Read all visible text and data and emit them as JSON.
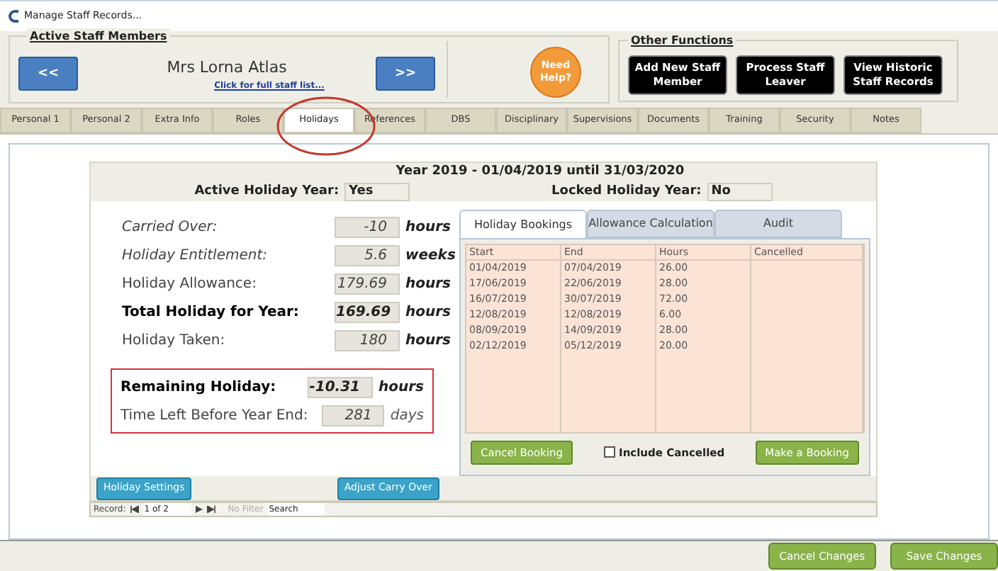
{
  "window": {
    "title": "Manage Staff Records..."
  },
  "header": {
    "section_title": "Active Staff Members",
    "prev": "<<",
    "staff_name": "Mrs Lorna Atlas",
    "staff_link": "Click for full staff list...",
    "next": ">>",
    "help": "Need Help?",
    "other_title": "Other Functions",
    "actions": [
      "Add New Staff Member",
      "Process Staff Leaver",
      "View Historic Staff Records"
    ]
  },
  "tabs": [
    {
      "label": "Personal 1",
      "selected": false
    },
    {
      "label": "Personal 2",
      "selected": false
    },
    {
      "label": "Extra Info",
      "selected": false
    },
    {
      "label": "Roles",
      "selected": false
    },
    {
      "label": "Holidays",
      "selected": true
    },
    {
      "label": "References",
      "selected": false
    },
    {
      "label": "DBS",
      "selected": false
    },
    {
      "label": "Disciplinary",
      "selected": false
    },
    {
      "label": "Supervisions",
      "selected": false
    },
    {
      "label": "Documents",
      "selected": false
    },
    {
      "label": "Training",
      "selected": false
    },
    {
      "label": "Security",
      "selected": false
    },
    {
      "label": "Notes",
      "selected": false
    }
  ],
  "year": {
    "title": "Year 2019 - 01/04/2019 until 31/03/2020",
    "active_label": "Active Holiday Year:",
    "active_value": "Yes",
    "locked_label": "Locked Holiday Year:",
    "locked_value": "No"
  },
  "fields": [
    {
      "kind": "italic",
      "label": "Carried Over:",
      "value": "-10",
      "unit": "hours"
    },
    {
      "kind": "italic",
      "label": "Holiday Entitlement:",
      "value": "5.6",
      "unit": "weeks"
    },
    {
      "kind": "plain",
      "label": "Holiday Allowance:",
      "value": "179.69",
      "unit": "hours"
    },
    {
      "kind": "bold",
      "label": "Total Holiday for Year:",
      "value": "169.69",
      "unit": "hours"
    },
    {
      "kind": "plain",
      "label": "Holiday Taken:",
      "value": "180",
      "unit": "hours"
    }
  ],
  "remaining": [
    {
      "kind": "bold",
      "label": "Remaining Holiday:",
      "value": "-10.31",
      "unit": "hours"
    },
    {
      "kind": "plain",
      "label": "Time Left Before Year End:",
      "value": "281",
      "unit": "days"
    }
  ],
  "left_buttons": [
    "Holiday Settings",
    "Adjust Carry Over"
  ],
  "record_nav": {
    "label": "Record:",
    "position": "1 of 2",
    "filter": "No Filter",
    "search": "Search"
  },
  "subtabs": [
    {
      "label": "Holiday Bookings",
      "selected": true
    },
    {
      "label": "Allowance Calculation",
      "selected": false
    },
    {
      "label": "Audit",
      "selected": false
    }
  ],
  "table": {
    "columns": [
      "Start",
      "End",
      "Hours",
      "Cancelled"
    ],
    "rows": [
      [
        "01/04/2019",
        "07/04/2019",
        "26.00"
      ],
      [
        "17/06/2019",
        "22/06/2019",
        "28.00"
      ],
      [
        "16/07/2019",
        "30/07/2019",
        "72.00"
      ],
      [
        "12/08/2019",
        "12/08/2019",
        "6.00"
      ],
      [
        "08/09/2019",
        "14/09/2019",
        "28.00"
      ],
      [
        "02/12/2019",
        "05/12/2019",
        "20.00"
      ]
    ]
  },
  "cancel_booking": "Cancel Booking",
  "include_cancelled": {
    "label": "Include Cancelled",
    "checked": false
  },
  "make_booking": "Make a Booking",
  "footer_buttons": [
    "Cancel Changes",
    "Save Changes"
  ]
}
